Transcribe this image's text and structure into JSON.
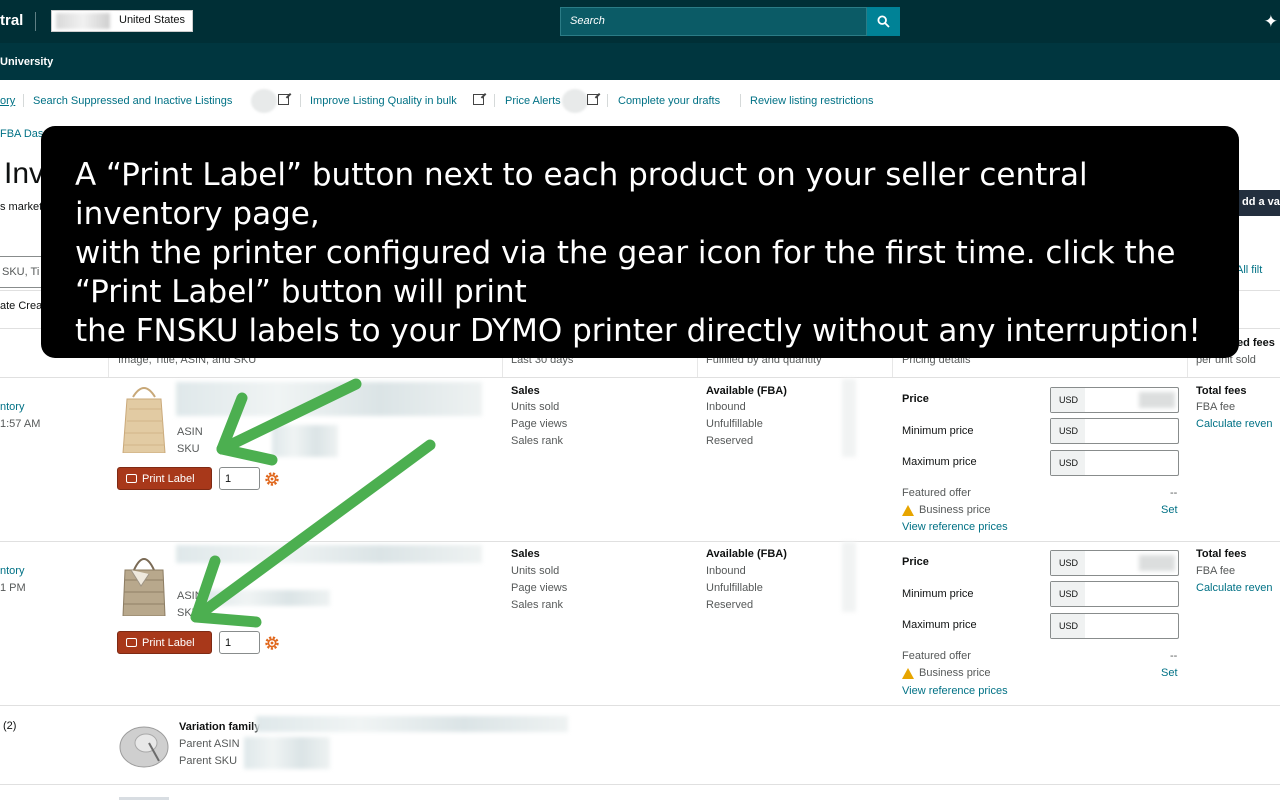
{
  "header": {
    "brand": "tral",
    "marketplace": "United States",
    "search_placeholder": "Search",
    "sub_nav": "University"
  },
  "quick_links": [
    {
      "label": "ory"
    },
    {
      "label": "Search Suppressed and Inactive Listings"
    },
    {
      "label": "Improve Listing Quality in bulk"
    },
    {
      "label": "Price Alerts"
    },
    {
      "label": "Complete your drafts"
    },
    {
      "label": "Review listing restrictions"
    }
  ],
  "fba_link": "FBA Das",
  "page": {
    "title": "Inv",
    "market_sub": "s market",
    "add_variation": "dd a var",
    "search_sku_placeholder": "SKU, Ti",
    "all_filters": "All filt",
    "date_created": "ate Crea"
  },
  "columns": {
    "product": "Image, Title, ASIN, and SKU",
    "sales": "Last 30 days",
    "fulfillment": "Fulfilled by and quantity",
    "pricing": "Pricing details",
    "fees_title": "ed fees",
    "fees_sub": "per unit sold"
  },
  "overlay": {
    "line1": "A “Print Label” button next to each product on your seller central inventory page,",
    "line2": "with the printer configured via the gear icon for the first time. click the “Print Label” button will print",
    "line3": "the FNSKU labels to your DYMO printer directly without any interruption!"
  },
  "rows": [
    {
      "status": "ntory",
      "time": "1:57 AM",
      "asin_label": "ASIN",
      "sku_label": "SKU",
      "print_label": "Print Label",
      "qty": "1",
      "sales": [
        "Sales",
        "Units sold",
        "Page views",
        "Sales rank"
      ],
      "fulfillment": [
        "Available (FBA)",
        "Inbound",
        "Unfulfillable",
        "Reserved"
      ],
      "price_label": "Price",
      "min_price_label": "Minimum price",
      "max_price_label": "Maximum price",
      "currency": "USD",
      "featured_offer": "Featured offer",
      "featured_value": "--",
      "business_price": "Business price",
      "set": "Set",
      "reference": "View reference prices",
      "total_fees": "Total fees",
      "fba_fee": "FBA fee",
      "calc": "Calculate reven"
    },
    {
      "status": "ntory",
      "time": "1 PM",
      "asin_label": "ASIN",
      "sku_label": "SKU",
      "print_label": "Print Label",
      "qty": "1",
      "sales": [
        "Sales",
        "Units sold",
        "Page views",
        "Sales rank"
      ],
      "fulfillment": [
        "Available (FBA)",
        "Inbound",
        "Unfulfillable",
        "Reserved"
      ],
      "price_label": "Price",
      "min_price_label": "Minimum price",
      "max_price_label": "Maximum price",
      "currency": "USD",
      "featured_offer": "Featured offer",
      "featured_value": "--",
      "business_price": "Business price",
      "set": "Set",
      "reference": "View reference prices",
      "total_fees": "Total fees",
      "fba_fee": "FBA fee",
      "calc": "Calculate reven"
    }
  ],
  "variation_row": {
    "count": "(2)",
    "title": "Variation family",
    "parent_asin": "Parent ASIN",
    "parent_sku": "Parent SKU"
  },
  "colors": {
    "topbar": "#002f36",
    "print_button": "#a8381a",
    "arrow": "#4caf50",
    "link": "#007185"
  },
  "icons": [
    "search-icon",
    "sparkle-icon",
    "external-link-icon",
    "printer-icon",
    "gear-icon",
    "warning-icon",
    "arrow-annotation"
  ]
}
